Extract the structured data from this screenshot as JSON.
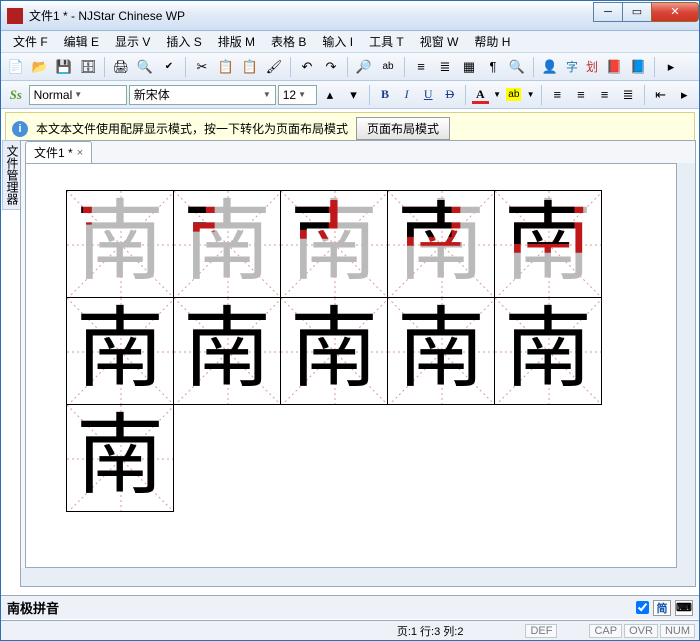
{
  "window": {
    "title": "文件1 * - NJStar Chinese WP"
  },
  "menus": {
    "file": "文件 F",
    "edit": "编辑 E",
    "view": "显示 V",
    "insert": "插入 S",
    "format": "排版 M",
    "table": "表格 B",
    "input": "输入 I",
    "tools": "工具 T",
    "window": "视窗 W",
    "help": "帮助 H"
  },
  "toolbar2": {
    "style_prefix": "Ss",
    "style": "Normal",
    "font": "新宋体",
    "size": "12"
  },
  "info": {
    "text": "本文本文件使用配屏显示模式，按一下转化为页面布局模式",
    "button": "页面布局模式"
  },
  "sidebar_label": "文件管理器",
  "tab": {
    "label": "文件1 *"
  },
  "character": "南",
  "stroke_cells": 11,
  "ime": {
    "name": "南极拼音",
    "simp": "简"
  },
  "status": {
    "pos": "页:1  行:3  列:2",
    "def": "DEF",
    "cap": "CAP",
    "ovr": "OVR",
    "num": "NUM"
  }
}
